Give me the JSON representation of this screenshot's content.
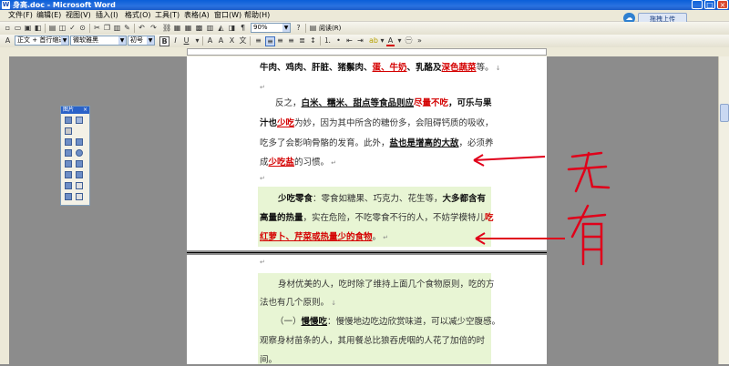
{
  "window": {
    "title": "身高.doc - Microsoft Word",
    "buttons": [
      "_",
      "□",
      "×"
    ]
  },
  "menu": {
    "items": [
      "文件(F)",
      "编辑(E)",
      "视图(V)",
      "插入(I)",
      "格式(O)",
      "工具(T)",
      "表格(A)",
      "窗口(W)",
      "帮助(H)"
    ],
    "cloud_label": "拖拽上传"
  },
  "toolbar": {
    "zoom": "90%",
    "reading_label": "阅读(R)",
    "style_combo": "正文 + 首行缩进",
    "font_combo": "微软雅黑",
    "size_combo": "初号",
    "bold": "B",
    "italic": "I",
    "underline": "U",
    "font_color": "#d40000"
  },
  "palette": {
    "title": "图片"
  },
  "document": {
    "page1": {
      "line1": {
        "a": "牛肉、鸡肉、肝脏、猪鬃肉、",
        "b": "蛋、牛奶",
        "c": "、乳酪及",
        "d": "深色蔬菜",
        "e": "等。"
      },
      "para2": {
        "l1": {
          "a": "反之，",
          "b": "白米、糯米、甜点等食品则应",
          "c": "尽量不吃",
          "d": "，可乐与果"
        },
        "l2": {
          "a": "汁也",
          "b": "少吃",
          "c": "为妙，因为其中所含的糖份多，会阻碍钙质的吸收，"
        },
        "l3": "吃多了会影响骨骼的发育。此外，",
        "l3b": "盐也是增高的大敌",
        "l3c": "，必须养",
        "l4": {
          "a": "成",
          "b": "少吃盐",
          "c": "的习惯。"
        }
      },
      "para3": {
        "l1": {
          "a": "少吃零食",
          "b": "：零食如糖果、巧克力、花生等，",
          "c": "大多都含有"
        },
        "l2": {
          "a": "高量的热量",
          "b": "，实在危险，不吃零食不行的人，不妨学模特儿",
          "c": "吃"
        },
        "l3": {
          "a": "红萝卜、芹菜或热量少的食物",
          "b": "。"
        }
      }
    },
    "page2": {
      "l1": "身材优美的人，吃时除了维持上面几个食物原则，吃的方",
      "l2": "法也有几个原则。",
      "l3a": "（一）",
      "l3b": "慢慢吃",
      "l3c": "：慢慢地边吃边欣赏味道，可以减少空腹感。",
      "l4": "观察身材苗条的人，其用餐总比狼吞虎咽的人花了加倍的时",
      "l5": "间。"
    }
  },
  "annotation": {
    "handwriting": "无有",
    "color": "#e0001a"
  }
}
